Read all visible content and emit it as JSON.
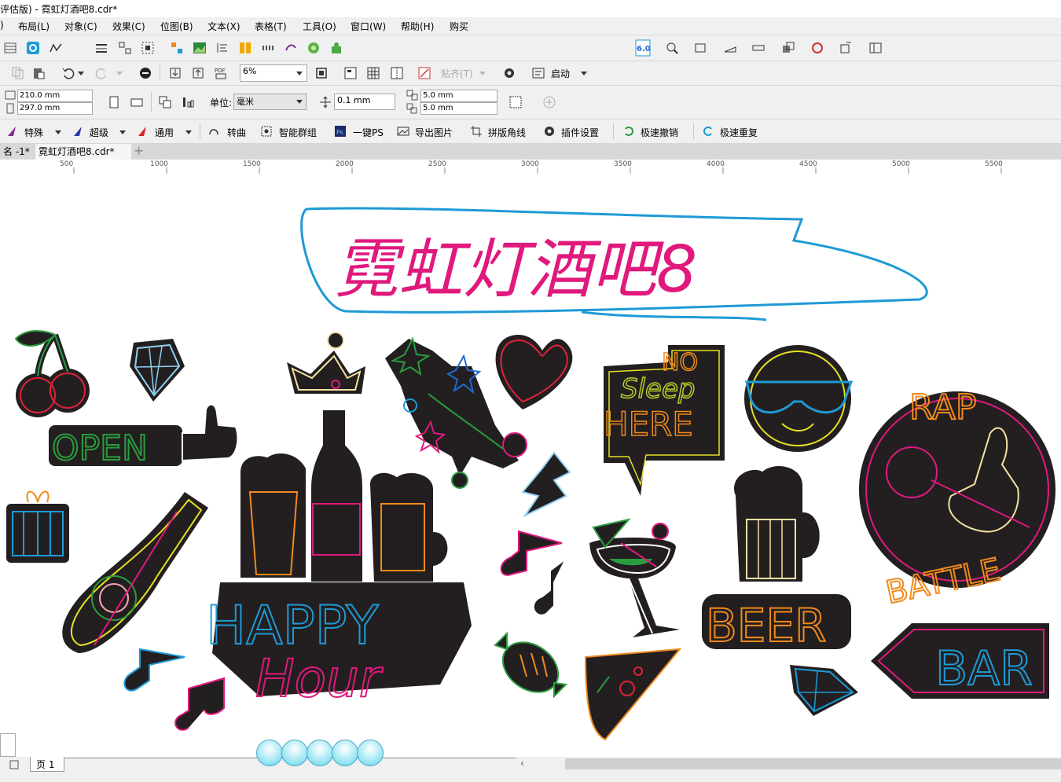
{
  "window": {
    "title": "评估版) - 霓虹灯酒吧8.cdr*"
  },
  "menu": [
    "布局(L)",
    "对象(C)",
    "效果(C)",
    "位图(B)",
    "文本(X)",
    "表格(T)",
    "工具(O)",
    "窗口(W)",
    "帮助(H)",
    "购买"
  ],
  "menu_first": ")",
  "toolbar2": {
    "zoom": "6%",
    "snap_label": "贴齐(T)",
    "launch_label": "启动",
    "plugin_version": "6.0"
  },
  "property_bar": {
    "width": "210.0 mm",
    "height": "297.0 mm",
    "unit_label": "单位:",
    "unit_value": "毫米",
    "nudge": "0.1 mm",
    "dup_x": "5.0 mm",
    "dup_y": "5.0 mm"
  },
  "plugin_bar": [
    "特殊",
    "超级",
    "通用",
    "转曲",
    "智能群组",
    "一键PS",
    "导出图片",
    "拼版角线",
    "插件设置",
    "极速撤销",
    "极速重复"
  ],
  "doc_tabs": [
    "名 -1*",
    "霓虹灯酒吧8.cdr*"
  ],
  "ruler_ticks": [
    "500",
    "1000",
    "1500",
    "2000",
    "2500",
    "3000",
    "3500",
    "4000",
    "4500",
    "5000",
    "5500"
  ],
  "canvas_art": {
    "title": "霓虹灯酒吧8",
    "open_sign": "OPEN",
    "no": "NO",
    "sleep": "Sleep",
    "here": "HERE",
    "rap": "RAP",
    "battle": "BATTLE",
    "happy": "HAPPY",
    "hour": "Hour",
    "beer": "BEER",
    "bar": "BAR"
  },
  "page_tab": "页 1",
  "colors": {
    "neon_pink": "#e0197d",
    "title_blue": "#1e9ad6",
    "sticker_dark": "#231f20",
    "orange": "#f08a1c"
  }
}
